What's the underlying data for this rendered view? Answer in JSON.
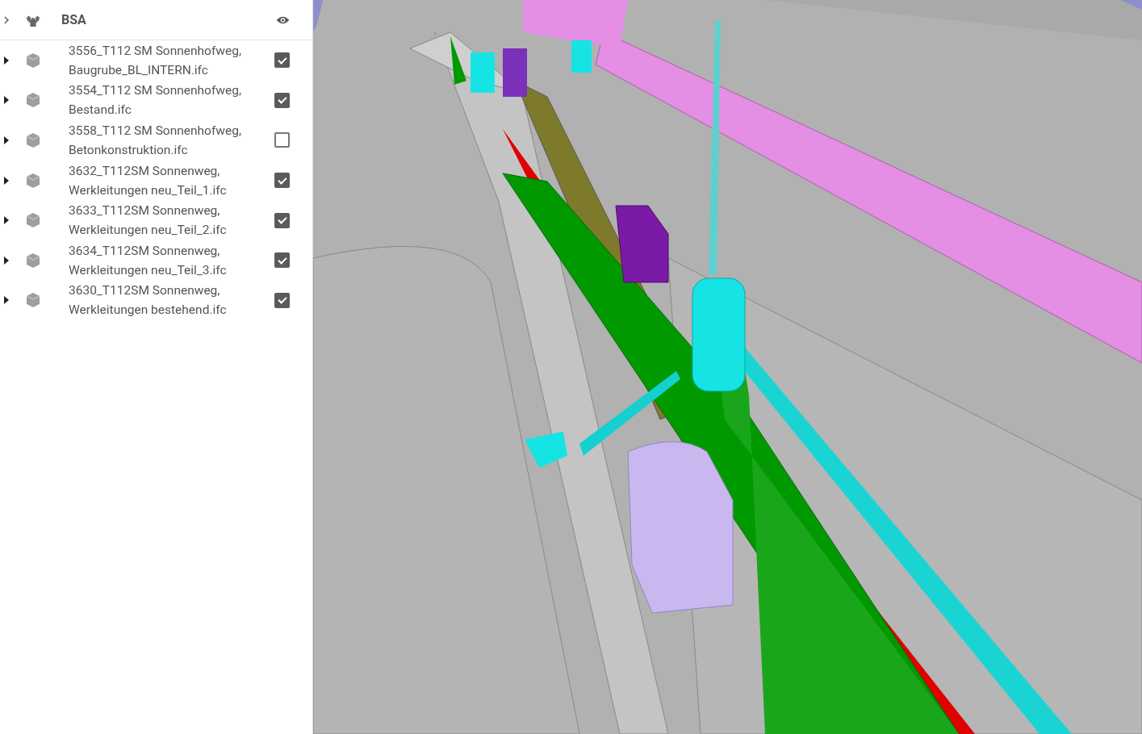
{
  "tree": {
    "name": "BSA",
    "models": [
      {
        "name": "3556_T112 SM Sonnenhofweg, Baugrube_BL_INTERN.ifc",
        "expanded": false,
        "checked": true
      },
      {
        "name": "3554_T112 SM Sonnenhofweg, Bestand.ifc",
        "expanded": false,
        "checked": true
      },
      {
        "name": "3558_T112 SM Sonnenhofweg, Betonkonstruktion.ifc",
        "expanded": false,
        "checked": false
      },
      {
        "name": "3632_T112SM Sonnenweg, Werkleitungen neu_Teil_1.ifc",
        "expanded": false,
        "checked": true
      },
      {
        "name": "3633_T112SM Sonnenweg, Werkleitungen neu_Teil_2.ifc",
        "expanded": false,
        "checked": true
      },
      {
        "name": "3634_T112SM Sonnenweg, Werkleitungen neu_Teil_3.ifc",
        "expanded": false,
        "checked": true
      },
      {
        "name": "3630_T112SM Sonnenweg, Werkleitungen bestehend.ifc",
        "expanded": false,
        "checked": true
      }
    ]
  }
}
